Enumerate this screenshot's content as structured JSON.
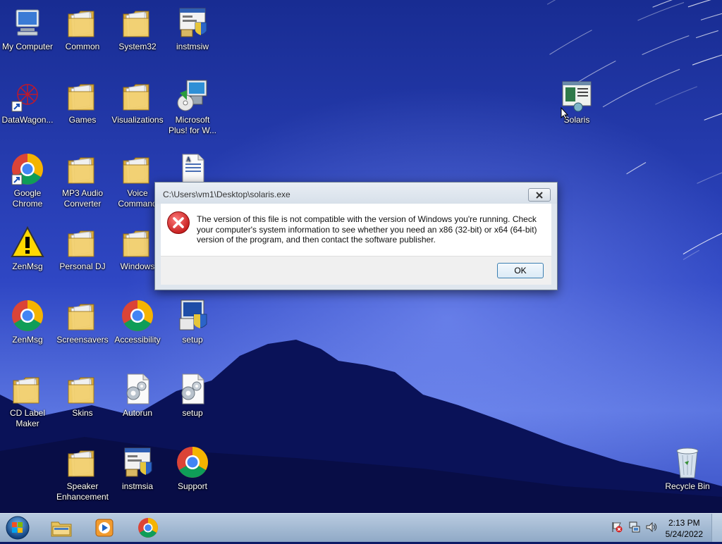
{
  "desktop": {
    "icons": [
      {
        "label": "My Computer"
      },
      {
        "label": "Common"
      },
      {
        "label": "System32"
      },
      {
        "label": "instmsiw"
      },
      {
        "label": "DataWagon..."
      },
      {
        "label": "Games"
      },
      {
        "label": "Visualizations"
      },
      {
        "label": "Microsoft Plus! for W..."
      },
      {
        "label": "Google Chrome"
      },
      {
        "label": "MP3 Audio Converter"
      },
      {
        "label": "Voice Command"
      },
      {
        "label": "ZenMsg"
      },
      {
        "label": "Personal DJ"
      },
      {
        "label": "Windows"
      },
      {
        "label": "ZenMsg"
      },
      {
        "label": "Screensavers"
      },
      {
        "label": "Accessibility"
      },
      {
        "label": "setup"
      },
      {
        "label": "CD Label Maker"
      },
      {
        "label": "Skins"
      },
      {
        "label": "Autorun"
      },
      {
        "label": "setup"
      },
      {
        "label": "Speaker Enhancement"
      },
      {
        "label": "instmsia"
      },
      {
        "label": "Support"
      },
      {
        "label": "Solaris"
      },
      {
        "label": "Recycle Bin"
      }
    ]
  },
  "dialog": {
    "title": "C:\\Users\\vm1\\Desktop\\solaris.exe",
    "message": "The version of this file is not compatible with the version of Windows you're running. Check your computer's system information to see whether you need an x86 (32-bit) or x64 (64-bit) version of the program, and then contact the software publisher.",
    "ok_label": "OK",
    "icon": "error-icon"
  },
  "taskbar": {
    "items": [
      "start-orb-icon",
      "file-explorer-icon",
      "media-player-icon",
      "chrome-icon"
    ],
    "tray_icons": [
      "action-center-flag-icon",
      "network-icon",
      "volume-icon"
    ],
    "time": "2:13 PM",
    "date": "5/24/2022"
  },
  "colors": {
    "wallpaper_sky": "#1b2fa0",
    "wallpaper_mountain": "#0a1150",
    "error_red": "#d92b2b",
    "taskbar": "#a9bfd8"
  }
}
